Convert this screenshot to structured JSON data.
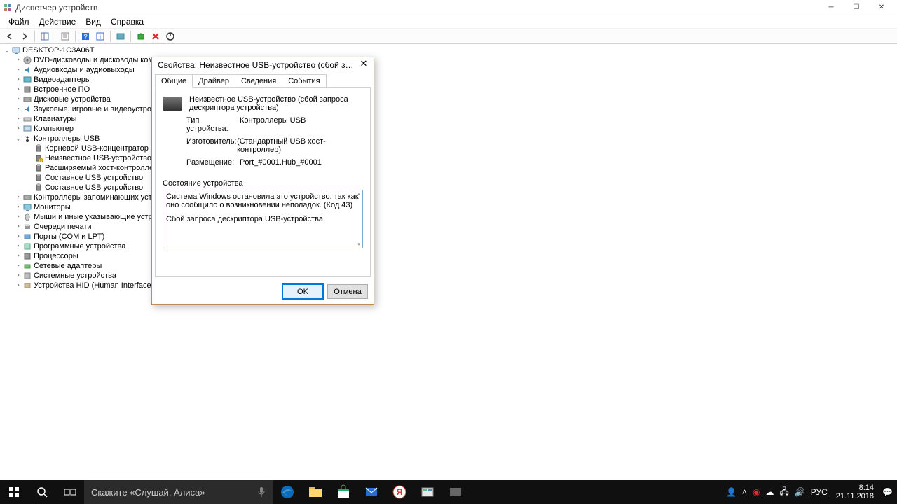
{
  "window": {
    "title": "Диспетчер устройств"
  },
  "menu": {
    "file": "Файл",
    "action": "Действие",
    "view": "Вид",
    "help": "Справка"
  },
  "tree": {
    "root": "DESKTOP-1C3A06T",
    "nodes": [
      "DVD-дисководы и дисководы компа",
      "Аудиовходы и аудиовыходы",
      "Видеоадаптеры",
      "Встроенное ПО",
      "Дисковые устройства",
      "Звуковые, игровые и видеоустройств",
      "Клавиатуры",
      "Компьютер"
    ],
    "usb": {
      "label": "Контроллеры USB",
      "children": [
        "Корневой USB-концентратор (USB",
        "Неизвестное USB-устройство (сбо",
        "Расширяемый хост-контроллер I",
        "Составное USB устройство",
        "Составное USB устройство"
      ]
    },
    "nodes2": [
      "Контроллеры запоминающих устрой",
      "Мониторы",
      "Мыши и иные указывающие устрой",
      "Очереди печати",
      "Порты (COM и LPT)",
      "Программные устройства",
      "Процессоры",
      "Сетевые адаптеры",
      "Системные устройства",
      "Устройства HID (Human Interface Dev"
    ]
  },
  "dialog": {
    "title": "Свойства: Неизвестное USB-устройство (сбой запроса дескрип…",
    "tabs": {
      "general": "Общие",
      "driver": "Драйвер",
      "details": "Сведения",
      "events": "События"
    },
    "device_name": "Неизвестное USB-устройство (сбой запроса дескриптора устройства)",
    "type_label": "Тип устройства:",
    "type_value": "Контроллеры USB",
    "manuf_label": "Изготовитель:",
    "manuf_value": "(Стандартный USB хост-контроллер)",
    "loc_label": "Размещение:",
    "loc_value": "Port_#0001.Hub_#0001",
    "status_label": "Состояние устройства",
    "status_text1": "Система Windows остановила это устройство, так как оно сообщило о возникновении неполадок. (Код 43)",
    "status_text2": "Сбой запроса дескриптора USB-устройства.",
    "ok": "OK",
    "cancel": "Отмена"
  },
  "taskbar": {
    "search_placeholder": "Скажите «Слушай, Алиса»",
    "lang": "РУС",
    "time": "8:14",
    "date": "21.11.2018"
  }
}
